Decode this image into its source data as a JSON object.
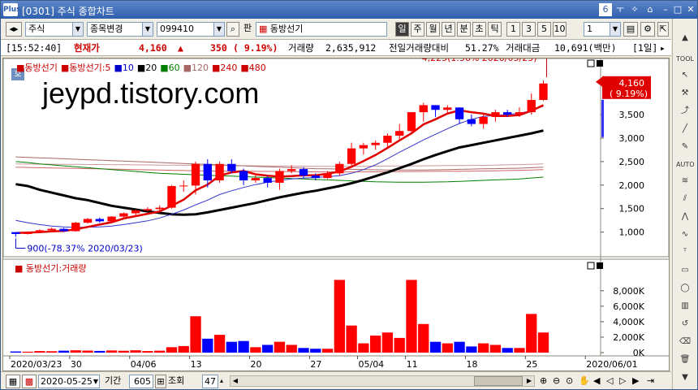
{
  "window": {
    "logo": "Plus",
    "title": "[0301] 주식 종합차트",
    "badge": "6",
    "controls": [
      "ㅜ",
      "ㅁ",
      "ㅡ",
      "ㅁ",
      "X"
    ]
  },
  "toolbar": {
    "market": "주식",
    "change_item": "종목변경",
    "code": "099410",
    "pan_label": "판",
    "name": "동방선기",
    "periods": [
      "일",
      "주",
      "월",
      "년",
      "분",
      "초",
      "틱"
    ],
    "selected_period": "일",
    "numbers": [
      "1",
      "3",
      "5",
      "10"
    ],
    "count": "1"
  },
  "info": {
    "time": "[15:52:40]",
    "price_label": "현재가",
    "price": "4,160",
    "up_arrow": "▲",
    "change": "350",
    "change_pct": "( 9.19%)",
    "volume_label": "거래량",
    "volume": "2,635,912",
    "prev_vol_label": "전일거래량대비",
    "prev_vol_pct": "51.27%",
    "amount_label": "거래대금",
    "amount": "10,691(백만)",
    "tf": "[1일]"
  },
  "price_panel": {
    "tag": "호",
    "legend": [
      {
        "text": "동방선기",
        "color": "#cc0000"
      },
      {
        "text": "동방선기:5",
        "color": "#cc0000"
      },
      {
        "text": "10",
        "color": "#0000cc"
      },
      {
        "text": "20",
        "color": "#000000"
      },
      {
        "text": "60",
        "color": "#008000"
      },
      {
        "text": "120",
        "color": "#aa6666"
      },
      {
        "text": "240",
        "color": "#cc0000"
      },
      {
        "text": "480",
        "color": "#cc0000"
      }
    ],
    "watermark": "jeypd.tistory.com",
    "high_annotation": "4,225(1.56% 2020/05/25)",
    "low_annotation": "900(-78.37% 2020/03/23)",
    "current_price_label": "4,160",
    "current_pct_label": "( 9.19%)"
  },
  "volume_panel": {
    "legend": "동방선기:거래량"
  },
  "chart_data": {
    "type": "candlestick",
    "price_axis": {
      "ticks": [
        1000,
        1500,
        2000,
        2500,
        3000,
        3500
      ],
      "labels": [
        "1,000",
        "1,500",
        "2,000",
        "2,500",
        "3,000",
        "3,500"
      ],
      "ylim": [
        580,
        4450
      ]
    },
    "volume_axis": {
      "ticks": [
        0,
        2000,
        4000,
        6000,
        8000
      ],
      "labels": [
        "0K",
        "2,000K",
        "4,000K",
        "6,000K",
        "8,000K"
      ],
      "ylim": [
        0,
        10500
      ]
    },
    "x_labels": [
      {
        "i": 0,
        "label": "2020/03/23"
      },
      {
        "i": 5,
        "label": "30"
      },
      {
        "i": 10,
        "label": "04/06"
      },
      {
        "i": 15,
        "label": "13"
      },
      {
        "i": 20,
        "label": "20"
      },
      {
        "i": 25,
        "label": "27"
      },
      {
        "i": 29,
        "label": "05/04"
      },
      {
        "i": 33,
        "label": "11"
      },
      {
        "i": 38,
        "label": "18"
      },
      {
        "i": 43,
        "label": "25"
      },
      {
        "i": 48,
        "label": "2020/06/01"
      }
    ],
    "candles": [
      [
        1000,
        1000,
        900,
        960,
        150
      ],
      [
        960,
        1010,
        950,
        990,
        120
      ],
      [
        990,
        1060,
        980,
        1040,
        200
      ],
      [
        1040,
        1100,
        1020,
        1070,
        180
      ],
      [
        1070,
        1090,
        1000,
        1020,
        250
      ],
      [
        1020,
        1220,
        1010,
        1200,
        300
      ],
      [
        1200,
        1300,
        1180,
        1280,
        260
      ],
      [
        1280,
        1310,
        1200,
        1230,
        220
      ],
      [
        1230,
        1340,
        1220,
        1330,
        280
      ],
      [
        1330,
        1420,
        1300,
        1400,
        240
      ],
      [
        1400,
        1480,
        1360,
        1460,
        300
      ],
      [
        1460,
        1530,
        1440,
        1490,
        200
      ],
      [
        1490,
        1570,
        1460,
        1520,
        250
      ],
      [
        1520,
        2000,
        1500,
        1980,
        700
      ],
      [
        1980,
        2100,
        1860,
        1990,
        850
      ],
      [
        1990,
        2500,
        1800,
        2450,
        4700
      ],
      [
        2450,
        2550,
        1950,
        2100,
        1800
      ],
      [
        2100,
        2500,
        2050,
        2450,
        2300
      ],
      [
        2450,
        2550,
        2250,
        2300,
        1400
      ],
      [
        2300,
        2350,
        2000,
        2100,
        1500
      ],
      [
        2100,
        2200,
        2050,
        2150,
        700
      ],
      [
        2150,
        2200,
        1950,
        2050,
        1000
      ],
      [
        2050,
        2350,
        1900,
        2300,
        1400
      ],
      [
        2300,
        2420,
        2250,
        2340,
        1000
      ],
      [
        2340,
        2380,
        2150,
        2200,
        600
      ],
      [
        2200,
        2250,
        2100,
        2150,
        500
      ],
      [
        2150,
        2300,
        2130,
        2250,
        500
      ],
      [
        2250,
        2500,
        2200,
        2450,
        9400
      ],
      [
        2450,
        2900,
        2400,
        2780,
        3500
      ],
      [
        2780,
        2900,
        2650,
        2850,
        1200
      ],
      [
        2850,
        2950,
        2750,
        2900,
        2200
      ],
      [
        2900,
        3100,
        2800,
        3050,
        2600
      ],
      [
        3050,
        3300,
        2950,
        3150,
        1900
      ],
      [
        3150,
        3550,
        3100,
        3550,
        9400
      ],
      [
        3550,
        3750,
        3350,
        3700,
        3700
      ],
      [
        3700,
        3700,
        3450,
        3600,
        1400
      ],
      [
        3600,
        3700,
        3500,
        3650,
        1200
      ],
      [
        3650,
        3650,
        3300,
        3400,
        1400
      ],
      [
        3400,
        3500,
        3250,
        3300,
        800
      ],
      [
        3300,
        3500,
        3200,
        3450,
        1200
      ],
      [
        3450,
        3600,
        3350,
        3550,
        1000
      ],
      [
        3550,
        3600,
        3450,
        3500,
        600
      ],
      [
        3500,
        3650,
        3450,
        3550,
        600
      ],
      [
        3550,
        3950,
        3500,
        3810,
        5000
      ],
      [
        3810,
        4225,
        3790,
        4160,
        2600
      ]
    ],
    "ma5": [
      980,
      990,
      1000,
      1015,
      1025,
      1060,
      1110,
      1160,
      1210,
      1290,
      1340,
      1390,
      1440,
      1560,
      1690,
      1890,
      2010,
      2200,
      2270,
      2300,
      2230,
      2200,
      2180,
      2190,
      2210,
      2210,
      2240,
      2290,
      2390,
      2510,
      2640,
      2790,
      2950,
      3100,
      3290,
      3400,
      3520,
      3590,
      3550,
      3520,
      3470,
      3470,
      3490,
      3580,
      3700
    ],
    "ma10": [
      1250,
      1200,
      1160,
      1130,
      1110,
      1100,
      1105,
      1110,
      1130,
      1160,
      1200,
      1240,
      1300,
      1380,
      1470,
      1580,
      1680,
      1800,
      1880,
      1950,
      2010,
      2060,
      2100,
      2130,
      2150,
      2160,
      2180,
      2200,
      2250,
      2330,
      2430,
      2560,
      2700,
      2830,
      2960,
      3080,
      3200,
      3310,
      3400,
      3460,
      3480,
      3500,
      3530,
      3580,
      3680
    ],
    "ma20": [
      2020,
      1980,
      1900,
      1840,
      1780,
      1720,
      1680,
      1620,
      1560,
      1520,
      1480,
      1440,
      1410,
      1380,
      1370,
      1380,
      1420,
      1470,
      1520,
      1570,
      1620,
      1680,
      1740,
      1790,
      1840,
      1880,
      1930,
      1980,
      2040,
      2110,
      2190,
      2270,
      2360,
      2450,
      2550,
      2640,
      2720,
      2800,
      2850,
      2900,
      2950,
      3000,
      3050,
      3100,
      3160
    ],
    "ma60": [
      2500,
      2480,
      2450,
      2430,
      2410,
      2390,
      2370,
      2350,
      2330,
      2310,
      2290,
      2270,
      2250,
      2240,
      2230,
      2220,
      2210,
      2200,
      2190,
      2180,
      2170,
      2160,
      2150,
      2140,
      2130,
      2120,
      2110,
      2100,
      2090,
      2080,
      2070,
      2065,
      2060,
      2060,
      2060,
      2065,
      2070,
      2080,
      2090,
      2100,
      2110,
      2120,
      2130,
      2150,
      2170
    ],
    "ma120": [
      2600,
      2590,
      2580,
      2570,
      2560,
      2550,
      2540,
      2530,
      2520,
      2510,
      2500,
      2490,
      2480,
      2470,
      2460,
      2450,
      2440,
      2430,
      2420,
      2410,
      2400,
      2390,
      2380,
      2370,
      2360,
      2350,
      2345,
      2340,
      2335,
      2330,
      2325,
      2320,
      2320,
      2320,
      2320,
      2325,
      2330,
      2335,
      2340,
      2345,
      2350,
      2355,
      2360,
      2370,
      2380
    ],
    "ma240": [
      2380,
      2375,
      2370,
      2365,
      2360,
      2355,
      2350,
      2345,
      2340,
      2335,
      2330,
      2325,
      2320,
      2315,
      2310,
      2305,
      2300,
      2298,
      2296,
      2294,
      2292,
      2290,
      2288,
      2286,
      2284,
      2282,
      2280,
      2280,
      2280,
      2280,
      2282,
      2284,
      2286,
      2288,
      2290,
      2292,
      2294,
      2296,
      2298,
      2300,
      2305,
      2310,
      2315,
      2320,
      2330
    ],
    "ma480": [
      2450,
      2448,
      2446,
      2444,
      2442,
      2440,
      2438,
      2436,
      2434,
      2432,
      2430,
      2428,
      2426,
      2424,
      2422,
      2420,
      2418,
      2416,
      2414,
      2412,
      2410,
      2408,
      2406,
      2404,
      2402,
      2400,
      2400,
      2400,
      2400,
      2400,
      2402,
      2404,
      2406,
      2408,
      2410,
      2412,
      2414,
      2416,
      2418,
      2420,
      2425,
      2430,
      2435,
      2440,
      2450
    ]
  },
  "bottom": {
    "date": "2020-05-25",
    "period_label": "기간",
    "period": "605",
    "view_label": "조회",
    "view_count": "47"
  },
  "right_icons": [
    "TOOL",
    "AUTO"
  ],
  "colors": {
    "up": "#ff0000",
    "down": "#0000ff",
    "accent": "#2e5fad"
  }
}
